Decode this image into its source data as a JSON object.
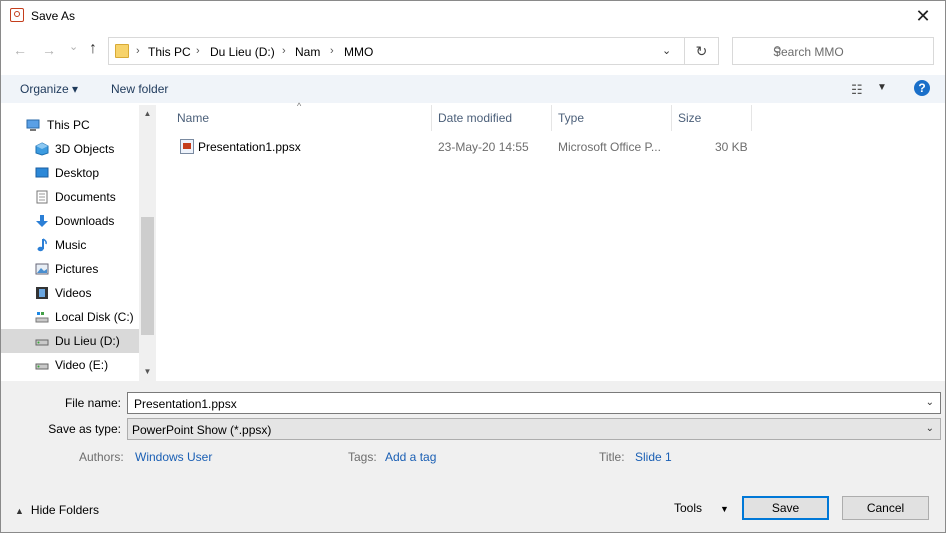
{
  "window": {
    "title": "Save As",
    "close_glyph": "✕"
  },
  "address": {
    "breadcrumbs": [
      "This PC",
      "Du Lieu (D:)",
      "Nam",
      "MMO"
    ],
    "separator": "›"
  },
  "nav_buttons": {
    "back": "←",
    "forward": "→",
    "recent": "⌄",
    "up": "↑",
    "refresh": "↻"
  },
  "search": {
    "placeholder": "Search MMO",
    "icon": "search-icon"
  },
  "toolbar": {
    "organize": "Organize ▾",
    "new_folder": "New folder",
    "help": "?"
  },
  "sidebar": {
    "items": [
      {
        "label": "This PC",
        "icon": "computer-icon"
      },
      {
        "label": "3D Objects",
        "icon": "cube-icon"
      },
      {
        "label": "Desktop",
        "icon": "desktop-icon"
      },
      {
        "label": "Documents",
        "icon": "document-icon"
      },
      {
        "label": "Downloads",
        "icon": "download-icon"
      },
      {
        "label": "Music",
        "icon": "music-note-icon"
      },
      {
        "label": "Pictures",
        "icon": "picture-icon"
      },
      {
        "label": "Videos",
        "icon": "film-icon"
      },
      {
        "label": "Local Disk (C:)",
        "icon": "drive-icon"
      },
      {
        "label": "Du Lieu (D:)",
        "icon": "drive-icon"
      },
      {
        "label": "Video (E:)",
        "icon": "drive-icon"
      }
    ],
    "selected": "Du Lieu (D:)"
  },
  "columns": {
    "name": "Name",
    "date": "Date modified",
    "type": "Type",
    "size": "Size"
  },
  "files": [
    {
      "name": "Presentation1.ppsx",
      "date": "23-May-20 14:55",
      "type": "Microsoft Office P...",
      "size": "30 KB"
    }
  ],
  "form": {
    "file_name_label": "File name:",
    "file_name_value": "Presentation1.ppsx",
    "save_type_label": "Save as type:",
    "save_type_value": "PowerPoint Show (*.ppsx)",
    "authors_label": "Authors:",
    "authors_value": "Windows User",
    "tags_label": "Tags:",
    "tags_value": "Add a tag",
    "title_label": "Title:",
    "title_value": "Slide 1"
  },
  "footer": {
    "hide_folders": "Hide Folders",
    "tools": "Tools",
    "save": "Save",
    "cancel": "Cancel"
  },
  "colors": {
    "accent": "#0078d7",
    "selected_nav": "#d9d9d9",
    "link": "#1a5fb4",
    "toolbar_bg": "#f0f4f9"
  }
}
